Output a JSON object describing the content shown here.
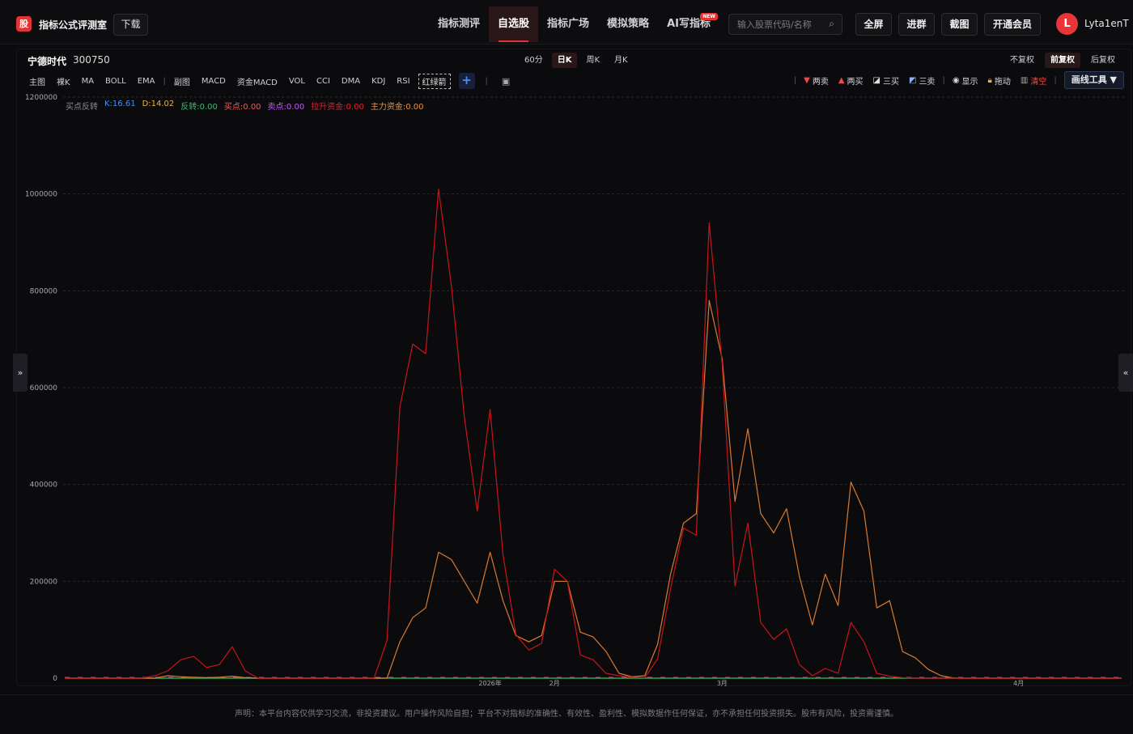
{
  "app": {
    "logo_char": "股",
    "brand": "指标公式评测室",
    "download": "下载"
  },
  "nav": [
    {
      "label": "指标测评",
      "active": false
    },
    {
      "label": "自选股",
      "active": true
    },
    {
      "label": "指标广场",
      "active": false
    },
    {
      "label": "模拟策略",
      "active": false
    },
    {
      "label": "AI写指标",
      "active": false,
      "badge": "NEW"
    }
  ],
  "search": {
    "placeholder": "输入股票代码/名称"
  },
  "top_buttons": {
    "fullscreen": "全屏",
    "join_group": "进群",
    "screenshot": "截图",
    "vip": "开通会员"
  },
  "user": {
    "initial": "L",
    "name": "Lyta1enT"
  },
  "stock": {
    "name": "宁德时代",
    "code": "300750"
  },
  "periods": [
    {
      "label": "60分",
      "active": false
    },
    {
      "label": "日K",
      "active": true
    },
    {
      "label": "周K",
      "active": false
    },
    {
      "label": "月K",
      "active": false
    }
  ],
  "adjusts": [
    {
      "label": "不复权",
      "active": false
    },
    {
      "label": "前复权",
      "active": true
    },
    {
      "label": "后复权",
      "active": false
    }
  ],
  "toolbar": {
    "main_chart": "主图",
    "naked_k": "裸K",
    "ma": "MA",
    "boll": "BOLL",
    "ema": "EMA",
    "sub_chart": "副图",
    "macd": "MACD",
    "fund_macd": "资金MACD",
    "vol": "VOL",
    "cci": "CCI",
    "dma": "DMA",
    "kdj": "KDJ",
    "rsi": "RSI",
    "red_green_arrow": "红绿箭"
  },
  "draw_tools": {
    "two_sell": "两卖",
    "two_buy": "两买",
    "three_buy": "三买",
    "three_sell": "三卖",
    "show": "显示",
    "drag": "拖动",
    "clear": "清空",
    "menu": "画线工具 ▼"
  },
  "legend": [
    {
      "text": "买点反转",
      "color": "#8a8a90"
    },
    {
      "text": "K:16.61",
      "color": "#4a90e2"
    },
    {
      "text": "D:14.02",
      "color": "#e8b73a"
    },
    {
      "text": "反转:0.00",
      "color": "#2ec46b"
    },
    {
      "text": "买点:0.00",
      "color": "#f05a5a"
    },
    {
      "text": "卖点:0.00",
      "color": "#c05af0"
    },
    {
      "text": "拉升资金:0.00",
      "color": "#e0202a"
    },
    {
      "text": "主力资金:0.00",
      "color": "#e8924a"
    }
  ],
  "footer": "声明：本平台内容仅供学习交流，非投资建议。用户操作风险自担；平台不对指标的准确性、有效性、盈利性、模拟数据作任何保证，亦不承担任何投资损失。股市有风险，投资需谨慎。",
  "chart_data": {
    "type": "line",
    "ylim": [
      0,
      1200000
    ],
    "y_ticks": [
      0,
      200000,
      400000,
      600000,
      800000,
      1000000,
      1200000
    ],
    "x_tick_labels": [
      {
        "index": 33,
        "label": "2026年"
      },
      {
        "index": 38,
        "label": "2月"
      },
      {
        "index": 51,
        "label": "3月"
      },
      {
        "index": 74,
        "label": "4月"
      }
    ],
    "grid": true,
    "colors": {
      "red_line": "#c8141a",
      "orange_line": "#d97a30",
      "green_line": "#2ea84e",
      "pink_line": "#d040a0"
    },
    "series": [
      {
        "name": "拉升资金",
        "values": [
          0,
          0,
          0,
          0,
          0,
          0,
          0,
          5000,
          15000,
          38000,
          45000,
          22000,
          28000,
          65000,
          15000,
          0,
          0,
          0,
          0,
          0,
          0,
          0,
          0,
          0,
          0,
          78000,
          560000,
          690000,
          670000,
          1010000,
          810000,
          540000,
          345000,
          555000,
          255000,
          90000,
          58000,
          72000,
          225000,
          200000,
          48000,
          38000,
          10000,
          5000,
          2000,
          1000,
          40000,
          185000,
          310000,
          295000,
          940000,
          650000,
          190000,
          320000,
          115000,
          80000,
          102000,
          28000,
          5000,
          20000,
          10000,
          115000,
          75000,
          10000,
          4000,
          1000,
          0,
          0,
          0,
          0,
          0,
          0,
          0,
          0,
          0,
          0,
          0,
          0,
          0,
          0,
          0,
          0,
          0
        ]
      },
      {
        "name": "主力资金",
        "values": [
          0,
          0,
          0,
          0,
          0,
          0,
          0,
          0,
          5000,
          3000,
          2000,
          1000,
          2000,
          4000,
          1000,
          0,
          0,
          0,
          0,
          0,
          0,
          0,
          0,
          0,
          0,
          0,
          75000,
          125000,
          145000,
          260000,
          245000,
          200000,
          155000,
          260000,
          160000,
          88000,
          75000,
          88000,
          200000,
          200000,
          95000,
          85000,
          55000,
          10000,
          3000,
          5000,
          70000,
          215000,
          320000,
          340000,
          780000,
          660000,
          365000,
          515000,
          340000,
          300000,
          350000,
          210000,
          110000,
          215000,
          150000,
          405000,
          345000,
          145000,
          160000,
          55000,
          42000,
          18000,
          5000,
          0,
          0,
          0,
          0,
          0,
          0,
          0,
          0,
          0,
          0,
          0,
          0,
          0,
          0
        ]
      }
    ]
  }
}
